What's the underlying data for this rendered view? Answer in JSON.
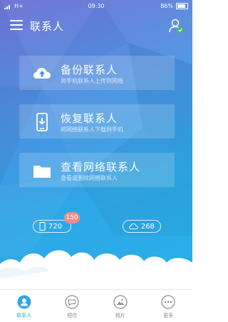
{
  "status_bar": {
    "carrier": "H+",
    "time": "09:30",
    "battery": "86%"
  },
  "app_bar": {
    "title": "联系人"
  },
  "cards": [
    {
      "title": "备份联系人",
      "subtitle": "将手机联系人上传到网络",
      "icon": "cloud-upload-icon"
    },
    {
      "title": "恢复联系人",
      "subtitle": "将网络联系人下载到手机",
      "icon": "phone-download-icon"
    },
    {
      "title": "查看网络联系人",
      "subtitle": "查看或删除网络联系人",
      "icon": "folder-icon"
    }
  ],
  "counts": {
    "phone": "720",
    "cloud": "268",
    "badge": "150"
  },
  "tabs": [
    {
      "label": "联系人",
      "icon": "contacts-icon",
      "active": true
    },
    {
      "label": "短信",
      "icon": "sms-icon",
      "active": false
    },
    {
      "label": "相片",
      "icon": "photos-icon",
      "active": false
    },
    {
      "label": "更多",
      "icon": "more-icon",
      "active": false
    }
  ],
  "colors": {
    "accent": "#2ea7e6",
    "badge": "#f08c8c",
    "tab_inactive": "#8a8a8a",
    "online_check": "#3fc05a"
  }
}
